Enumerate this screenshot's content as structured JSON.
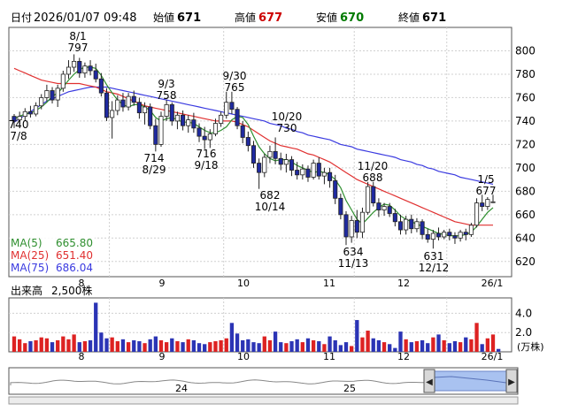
{
  "header": {
    "date_label": "日付",
    "datetime": "2026/01/07 09:48",
    "open_label": "始値",
    "open_value": "671",
    "high_label": "高値",
    "high_value": "677",
    "low_label": "安値",
    "low_value": "670",
    "close_label": "終値",
    "close_value": "671"
  },
  "colors": {
    "up_candle": "#ffffff",
    "down_candle": "#1f2aa0",
    "ma5": "#2f8f2f",
    "ma25": "#e03030",
    "ma75": "#3a3ae0",
    "high_value": "#cc0000",
    "low_value": "#007a00",
    "volume_up": "#dd2222",
    "volume_down": "#2b34b5",
    "navigator_fill": "#a9c2f0"
  },
  "legend": {
    "ma5_label": "MA(5)",
    "ma5_value": "665.80",
    "ma25_label": "MA(25)",
    "ma25_value": "651.40",
    "ma75_label": "MA(75)",
    "ma75_value": "686.04"
  },
  "volume_header": {
    "label": "出来高",
    "value": "2,500株"
  },
  "navigator": {
    "labels": [
      "24",
      "25"
    ]
  },
  "chart_data": [
    {
      "type": "candlestick",
      "title": "",
      "ylim": [
        607,
        820
      ],
      "y_ticks": [
        "800",
        "780",
        "760",
        "740",
        "720",
        "700",
        "680",
        "660",
        "640",
        "620"
      ],
      "x_ticks": [
        "8",
        "9",
        "10",
        "11",
        "12",
        "26/1"
      ],
      "grid": true,
      "ohlc": [
        {
          "o": 744,
          "h": 746,
          "l": 734,
          "c": 740
        },
        {
          "o": 741,
          "h": 748,
          "l": 737,
          "c": 744
        },
        {
          "o": 744,
          "h": 751,
          "l": 740,
          "c": 748
        },
        {
          "o": 748,
          "h": 753,
          "l": 743,
          "c": 746
        },
        {
          "o": 746,
          "h": 756,
          "l": 744,
          "c": 753
        },
        {
          "o": 753,
          "h": 763,
          "l": 750,
          "c": 760
        },
        {
          "o": 760,
          "h": 771,
          "l": 757,
          "c": 766
        },
        {
          "o": 766,
          "h": 769,
          "l": 755,
          "c": 758
        },
        {
          "o": 758,
          "h": 771,
          "l": 752,
          "c": 768
        },
        {
          "o": 768,
          "h": 783,
          "l": 765,
          "c": 780
        },
        {
          "o": 780,
          "h": 792,
          "l": 776,
          "c": 786
        },
        {
          "o": 786,
          "h": 797,
          "l": 782,
          "c": 791
        },
        {
          "o": 791,
          "h": 794,
          "l": 777,
          "c": 781
        },
        {
          "o": 781,
          "h": 790,
          "l": 777,
          "c": 787
        },
        {
          "o": 787,
          "h": 792,
          "l": 779,
          "c": 783
        },
        {
          "o": 783,
          "h": 789,
          "l": 773,
          "c": 776
        },
        {
          "o": 776,
          "h": 781,
          "l": 761,
          "c": 764
        },
        {
          "o": 764,
          "h": 768,
          "l": 740,
          "c": 743
        },
        {
          "o": 743,
          "h": 757,
          "l": 725,
          "c": 749
        },
        {
          "o": 749,
          "h": 762,
          "l": 745,
          "c": 758
        },
        {
          "o": 758,
          "h": 764,
          "l": 748,
          "c": 752
        },
        {
          "o": 752,
          "h": 764,
          "l": 749,
          "c": 761
        },
        {
          "o": 761,
          "h": 766,
          "l": 753,
          "c": 756
        },
        {
          "o": 756,
          "h": 760,
          "l": 742,
          "c": 747
        },
        {
          "o": 747,
          "h": 756,
          "l": 737,
          "c": 752
        },
        {
          "o": 752,
          "h": 755,
          "l": 733,
          "c": 736
        },
        {
          "o": 736,
          "h": 742,
          "l": 714,
          "c": 720
        },
        {
          "o": 720,
          "h": 748,
          "l": 718,
          "c": 744
        },
        {
          "o": 744,
          "h": 758,
          "l": 740,
          "c": 754
        },
        {
          "o": 754,
          "h": 756,
          "l": 736,
          "c": 740
        },
        {
          "o": 740,
          "h": 748,
          "l": 733,
          "c": 745
        },
        {
          "o": 745,
          "h": 749,
          "l": 732,
          "c": 736
        },
        {
          "o": 736,
          "h": 745,
          "l": 730,
          "c": 741
        },
        {
          "o": 741,
          "h": 747,
          "l": 730,
          "c": 734
        },
        {
          "o": 734,
          "h": 738,
          "l": 722,
          "c": 727
        },
        {
          "o": 727,
          "h": 735,
          "l": 716,
          "c": 724
        },
        {
          "o": 724,
          "h": 733,
          "l": 717,
          "c": 729
        },
        {
          "o": 729,
          "h": 742,
          "l": 727,
          "c": 738
        },
        {
          "o": 738,
          "h": 748,
          "l": 735,
          "c": 745
        },
        {
          "o": 745,
          "h": 765,
          "l": 742,
          "c": 756
        },
        {
          "o": 756,
          "h": 765,
          "l": 746,
          "c": 750
        },
        {
          "o": 750,
          "h": 752,
          "l": 733,
          "c": 736
        },
        {
          "o": 736,
          "h": 740,
          "l": 721,
          "c": 726
        },
        {
          "o": 726,
          "h": 731,
          "l": 714,
          "c": 719
        },
        {
          "o": 719,
          "h": 723,
          "l": 700,
          "c": 704
        },
        {
          "o": 704,
          "h": 708,
          "l": 682,
          "c": 696
        },
        {
          "o": 696,
          "h": 712,
          "l": 692,
          "c": 709
        },
        {
          "o": 709,
          "h": 719,
          "l": 704,
          "c": 714
        },
        {
          "o": 714,
          "h": 726,
          "l": 703,
          "c": 708
        },
        {
          "o": 708,
          "h": 713,
          "l": 698,
          "c": 703
        },
        {
          "o": 703,
          "h": 712,
          "l": 696,
          "c": 707
        },
        {
          "o": 707,
          "h": 710,
          "l": 693,
          "c": 698
        },
        {
          "o": 698,
          "h": 705,
          "l": 690,
          "c": 694
        },
        {
          "o": 694,
          "h": 703,
          "l": 690,
          "c": 699
        },
        {
          "o": 699,
          "h": 702,
          "l": 688,
          "c": 692
        },
        {
          "o": 692,
          "h": 707,
          "l": 690,
          "c": 704
        },
        {
          "o": 704,
          "h": 709,
          "l": 690,
          "c": 693
        },
        {
          "o": 693,
          "h": 700,
          "l": 686,
          "c": 696
        },
        {
          "o": 696,
          "h": 700,
          "l": 683,
          "c": 689
        },
        {
          "o": 689,
          "h": 694,
          "l": 669,
          "c": 674
        },
        {
          "o": 674,
          "h": 678,
          "l": 656,
          "c": 660
        },
        {
          "o": 660,
          "h": 663,
          "l": 634,
          "c": 641
        },
        {
          "o": 641,
          "h": 659,
          "l": 636,
          "c": 655
        },
        {
          "o": 655,
          "h": 664,
          "l": 640,
          "c": 645
        },
        {
          "o": 645,
          "h": 666,
          "l": 640,
          "c": 662
        },
        {
          "o": 662,
          "h": 688,
          "l": 660,
          "c": 684
        },
        {
          "o": 684,
          "h": 688,
          "l": 667,
          "c": 670
        },
        {
          "o": 670,
          "h": 674,
          "l": 658,
          "c": 664
        },
        {
          "o": 664,
          "h": 670,
          "l": 659,
          "c": 667
        },
        {
          "o": 667,
          "h": 670,
          "l": 658,
          "c": 661
        },
        {
          "o": 661,
          "h": 665,
          "l": 650,
          "c": 654
        },
        {
          "o": 654,
          "h": 660,
          "l": 643,
          "c": 647
        },
        {
          "o": 647,
          "h": 659,
          "l": 643,
          "c": 656
        },
        {
          "o": 656,
          "h": 660,
          "l": 644,
          "c": 648
        },
        {
          "o": 648,
          "h": 657,
          "l": 645,
          "c": 654
        },
        {
          "o": 654,
          "h": 656,
          "l": 639,
          "c": 643
        },
        {
          "o": 643,
          "h": 648,
          "l": 636,
          "c": 639
        },
        {
          "o": 639,
          "h": 647,
          "l": 631,
          "c": 644
        },
        {
          "o": 644,
          "h": 649,
          "l": 638,
          "c": 641
        },
        {
          "o": 641,
          "h": 647,
          "l": 639,
          "c": 645
        },
        {
          "o": 645,
          "h": 648,
          "l": 638,
          "c": 642
        },
        {
          "o": 642,
          "h": 645,
          "l": 635,
          "c": 640
        },
        {
          "o": 640,
          "h": 647,
          "l": 637,
          "c": 645
        },
        {
          "o": 645,
          "h": 648,
          "l": 638,
          "c": 643
        },
        {
          "o": 643,
          "h": 653,
          "l": 641,
          "c": 651
        },
        {
          "o": 651,
          "h": 674,
          "l": 649,
          "c": 670
        },
        {
          "o": 670,
          "h": 677,
          "l": 663,
          "c": 667
        },
        {
          "o": 667,
          "h": 675,
          "l": 664,
          "c": 673
        },
        {
          "o": 671,
          "h": 677,
          "l": 670,
          "c": 671
        }
      ],
      "ma5": [
        742,
        744,
        746,
        747,
        749,
        752,
        756,
        761,
        764,
        769,
        775,
        780,
        784,
        786,
        786,
        785,
        779,
        771,
        764,
        758,
        754,
        752,
        754,
        754,
        752,
        749,
        743,
        740,
        742,
        743,
        741,
        739,
        739,
        738,
        735,
        732,
        730,
        730,
        732,
        735,
        741,
        744,
        743,
        737,
        727,
        718,
        712,
        708,
        706,
        707,
        707,
        705,
        702,
        700,
        698,
        696,
        697,
        696,
        694,
        690,
        683,
        672,
        664,
        656,
        652,
        657,
        662,
        666,
        669,
        668,
        664,
        659,
        656,
        654,
        652,
        650,
        648,
        646,
        644,
        643,
        642,
        642,
        642,
        643,
        645,
        650,
        656,
        662,
        666
      ],
      "ma25": [
        785,
        783,
        781,
        779,
        777,
        775,
        774,
        773,
        772,
        772,
        772,
        772,
        772,
        771,
        770,
        769,
        767,
        765,
        764,
        763,
        761,
        759,
        757,
        755,
        753,
        752,
        751,
        750,
        749,
        748,
        747,
        746,
        745,
        744,
        743,
        742,
        741,
        740,
        740,
        740,
        740,
        739,
        737,
        735,
        732,
        729,
        726,
        723,
        721,
        719,
        718,
        717,
        716,
        714,
        712,
        711,
        709,
        707,
        705,
        702,
        699,
        696,
        693,
        690,
        688,
        686,
        684,
        682,
        680,
        678,
        676,
        674,
        672,
        670,
        668,
        666,
        664,
        662,
        660,
        658,
        656,
        654,
        653,
        652,
        651,
        651,
        651,
        651,
        651
      ],
      "ma75": [
        739,
        742,
        745,
        748,
        751,
        754,
        757,
        759,
        761,
        763,
        765,
        766,
        767,
        768,
        769,
        769,
        769,
        769,
        768,
        767,
        766,
        765,
        764,
        763,
        762,
        761,
        760,
        759,
        758,
        757,
        756,
        755,
        754,
        753,
        752,
        751,
        750,
        749,
        748,
        747,
        746,
        745,
        744,
        743,
        742,
        741,
        740,
        738,
        737,
        736,
        734,
        733,
        731,
        730,
        728,
        727,
        726,
        725,
        724,
        722,
        720,
        719,
        718,
        716,
        715,
        714,
        713,
        712,
        711,
        710,
        709,
        707,
        706,
        705,
        703,
        702,
        700,
        699,
        697,
        696,
        695,
        694,
        692,
        691,
        690,
        689,
        688,
        687,
        686
      ]
    },
    {
      "type": "bar",
      "title": "",
      "ylabel": "(万株)",
      "ylim": [
        0,
        5.6
      ],
      "y_ticks": [
        "4.0",
        "2.0"
      ],
      "x_ticks": [
        "8",
        "9",
        "10",
        "11",
        "12",
        "26/1"
      ],
      "values": [
        1.6,
        1.3,
        0.9,
        1.1,
        1.2,
        1.5,
        1.4,
        1.0,
        1.2,
        1.6,
        1.3,
        1.8,
        1.0,
        1.1,
        1.2,
        5.1,
        2.0,
        1.4,
        1.5,
        1.1,
        1.3,
        1.0,
        1.2,
        1.1,
        0.9,
        1.3,
        1.6,
        1.2,
        1.0,
        1.4,
        1.1,
        1.0,
        1.3,
        1.2,
        0.9,
        0.8,
        1.0,
        1.1,
        1.2,
        1.4,
        3.0,
        1.9,
        1.2,
        1.3,
        1.0,
        0.9,
        1.6,
        1.2,
        2.1,
        1.0,
        0.9,
        1.1,
        1.3,
        1.0,
        1.4,
        1.2,
        1.1,
        0.8,
        1.6,
        1.2,
        0.7,
        1.0,
        0.6,
        3.3,
        1.5,
        2.2,
        1.4,
        1.2,
        1.0,
        0.8,
        0.4,
        2.1,
        1.3,
        1.0,
        1.1,
        1.2,
        0.9,
        1.5,
        1.8,
        1.2,
        0.9,
        1.1,
        1.0,
        1.5,
        1.3,
        3.0,
        0.8,
        1.4,
        1.8,
        0.3
      ],
      "up": [
        true,
        true,
        true,
        false,
        true,
        true,
        true,
        false,
        true,
        true,
        true,
        true,
        false,
        true,
        false,
        false,
        false,
        false,
        true,
        true,
        false,
        true,
        false,
        false,
        true,
        false,
        false,
        true,
        true,
        false,
        true,
        false,
        true,
        false,
        false,
        false,
        true,
        true,
        true,
        true,
        false,
        false,
        false,
        false,
        false,
        false,
        true,
        true,
        false,
        false,
        true,
        false,
        false,
        true,
        false,
        true,
        false,
        true,
        false,
        false,
        false,
        false,
        true,
        false,
        true,
        true,
        false,
        false,
        true,
        false,
        false,
        false,
        true,
        false,
        true,
        false,
        false,
        true,
        false,
        true,
        false,
        false,
        true,
        false,
        true,
        true,
        false,
        true,
        true,
        false
      ]
    }
  ],
  "price_annotations": [
    {
      "label": "8/1",
      "value": "797"
    },
    {
      "label": "740",
      "value": "7/8"
    },
    {
      "label": "9/3",
      "value": "758"
    },
    {
      "label": "714",
      "value": "8/29"
    },
    {
      "label": "716",
      "value": "9/18"
    },
    {
      "label": "9/30",
      "value": "765"
    },
    {
      "label": "10/20",
      "value": "730"
    },
    {
      "label": "682",
      "value": "10/14"
    },
    {
      "label": "11/20",
      "value": "688"
    },
    {
      "label": "634",
      "value": "11/13"
    },
    {
      "label": "631",
      "value": "12/12"
    },
    {
      "label": "1/5",
      "value": "677"
    }
  ]
}
